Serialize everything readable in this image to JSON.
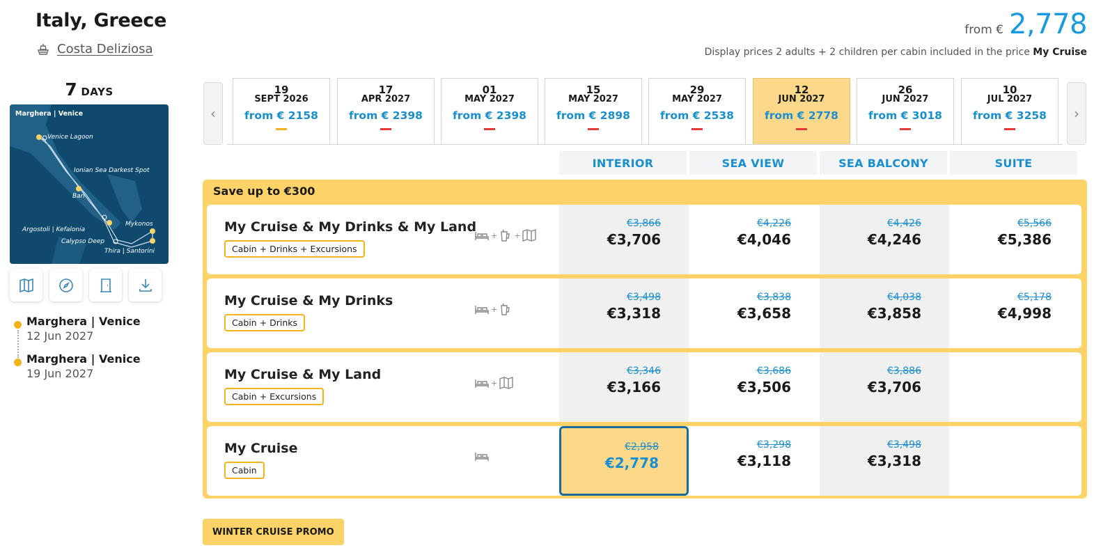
{
  "header": {
    "title": "Italy, Greece",
    "ship_name": "Costa Deliziosa",
    "from_label": "from €",
    "from_price": "2,778",
    "disclaimer_prefix": "Display prices 2 adults + 2 children per cabin included in the price",
    "disclaimer_bold": "My Cruise"
  },
  "duration": {
    "number": "7",
    "unit": "DAYS"
  },
  "map": {
    "labels": [
      "Marghera | Venice",
      "Venice Lagoon",
      "Ionian Sea Darkest Spot",
      "Bari",
      "Mykonos",
      "Argostoli | Kefalonia",
      "Calypso Deep",
      "Thira | Santorini"
    ],
    "colors": {
      "sea": "#0f4a6e",
      "land": "#2a6b92",
      "route": "#cfe3f0",
      "port": "#f6d36a"
    }
  },
  "tools": [
    "map-icon",
    "compass-icon",
    "door-icon",
    "download-icon"
  ],
  "itinerary": [
    {
      "port": "Marghera | Venice",
      "date": "12 Jun 2027"
    },
    {
      "port": "Marghera | Venice",
      "date": "19 Jun 2027"
    }
  ],
  "dates": [
    {
      "day": "19",
      "month": "SEPT 2026",
      "price": "from € 2158",
      "marker": "yellow"
    },
    {
      "day": "17",
      "month": "APR 2027",
      "price": "from € 2398",
      "marker": "red"
    },
    {
      "day": "01",
      "month": "MAY 2027",
      "price": "from € 2398",
      "marker": "red"
    },
    {
      "day": "15",
      "month": "MAY 2027",
      "price": "from € 2898",
      "marker": "red"
    },
    {
      "day": "29",
      "month": "MAY 2027",
      "price": "from € 2538",
      "marker": "red"
    },
    {
      "day": "12",
      "month": "JUN 2027",
      "price": "from € 2778",
      "marker": "red",
      "active": true
    },
    {
      "day": "26",
      "month": "JUN 2027",
      "price": "from € 3018",
      "marker": "red"
    },
    {
      "day": "10",
      "month": "JUL 2027",
      "price": "from € 3258",
      "marker": "red"
    }
  ],
  "cabins": [
    "INTERIOR",
    "SEA VIEW",
    "SEA BALCONY",
    "SUITE"
  ],
  "save_label": "Save up to €300",
  "packages": [
    {
      "name": "My Cruise & My Drinks & My Land",
      "tag": "Cabin + Drinks + Excursions",
      "icons": [
        "bed-icon",
        "drinks-icon",
        "map-icon"
      ],
      "prices": [
        {
          "old": "€3,866",
          "new": "€3,706"
        },
        {
          "old": "€4,226",
          "new": "€4,046"
        },
        {
          "old": "€4,426",
          "new": "€4,246"
        },
        {
          "old": "€5,566",
          "new": "€5,386"
        }
      ]
    },
    {
      "name": "My Cruise & My Drinks",
      "tag": "Cabin + Drinks",
      "icons": [
        "bed-icon",
        "drinks-icon"
      ],
      "prices": [
        {
          "old": "€3,498",
          "new": "€3,318"
        },
        {
          "old": "€3,838",
          "new": "€3,658"
        },
        {
          "old": "€4,038",
          "new": "€3,858"
        },
        {
          "old": "€5,178",
          "new": "€4,998"
        }
      ]
    },
    {
      "name": "My Cruise & My Land",
      "tag": "Cabin + Excursions",
      "icons": [
        "bed-icon",
        "map-icon"
      ],
      "prices": [
        {
          "old": "€3,346",
          "new": "€3,166"
        },
        {
          "old": "€3,686",
          "new": "€3,506"
        },
        {
          "old": "€3,886",
          "new": "€3,706"
        }
      ]
    },
    {
      "name": "My Cruise",
      "tag": "Cabin",
      "icons": [
        "bed-icon"
      ],
      "prices": [
        {
          "old": "€2,958",
          "new": "€2,778",
          "selected": true
        },
        {
          "old": "€3,298",
          "new": "€3,118"
        },
        {
          "old": "€3,498",
          "new": "€3,318"
        }
      ]
    }
  ],
  "promo_label": "WINTER CRUISE PROMO",
  "colors": {
    "accent_blue": "#1a9ae0",
    "highlight_yellow": "#fdd266",
    "selected_border": "#1c6b96",
    "marker_red": "#e53935"
  }
}
